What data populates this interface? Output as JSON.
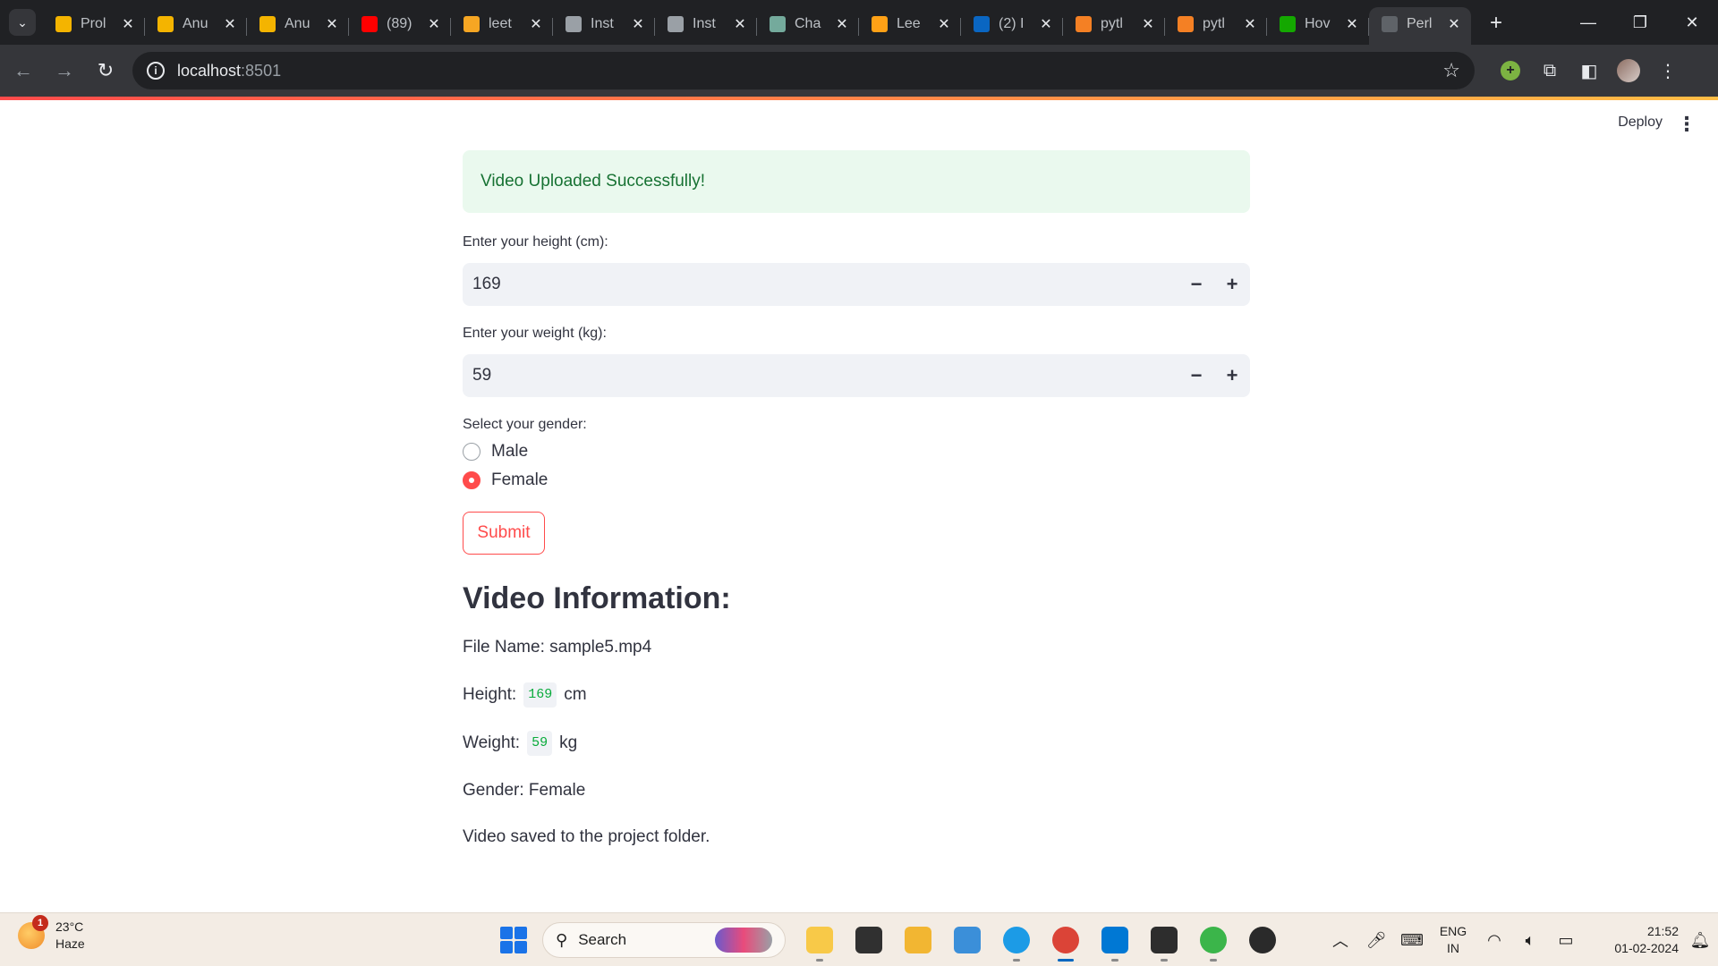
{
  "browser": {
    "tabs": [
      {
        "label": "Prol",
        "icon": "bar-chart-icon",
        "color": "#f4b400"
      },
      {
        "label": "Anu",
        "icon": "bar-chart-icon",
        "color": "#f4b400"
      },
      {
        "label": "Anu",
        "icon": "bar-chart-icon",
        "color": "#f4b400"
      },
      {
        "label": "(89)",
        "icon": "youtube-icon",
        "color": "#ff0000"
      },
      {
        "label": "leet",
        "icon": "hand-icon",
        "color": "#f6a623"
      },
      {
        "label": "Inst",
        "icon": "swirl-icon",
        "color": "#9aa0a6"
      },
      {
        "label": "Inst",
        "icon": "swirl-icon",
        "color": "#9aa0a6"
      },
      {
        "label": "Cha",
        "icon": "chatgpt-icon",
        "color": "#74aa9c"
      },
      {
        "label": "Lee",
        "icon": "leetcode-icon",
        "color": "#ffa116"
      },
      {
        "label": "(2) I",
        "icon": "linkedin-icon",
        "color": "#0a66c2"
      },
      {
        "label": "pytl",
        "icon": "stackoverflow-icon",
        "color": "#f48024"
      },
      {
        "label": "pytl",
        "icon": "stackoverflow-icon",
        "color": "#f48024"
      },
      {
        "label": "Hov",
        "icon": "upwork-icon",
        "color": "#14a800"
      },
      {
        "label": "Perl",
        "icon": "loading-icon",
        "color": "#5f6368"
      }
    ],
    "url_host": "localhost",
    "url_port": ":8501"
  },
  "app": {
    "deploy_label": "Deploy",
    "success_message": "Video Uploaded Successfully!",
    "height_label": "Enter your height (cm):",
    "height_value": "169",
    "weight_label": "Enter your weight (kg):",
    "weight_value": "59",
    "gender_label": "Select your gender:",
    "gender_options": [
      "Male",
      "Female"
    ],
    "gender_selected": "Female",
    "submit_label": "Submit",
    "info_heading": "Video Information:",
    "file_name_line": "File Name: sample5.mp4",
    "height_prefix": "Height:",
    "height_code": "169",
    "height_unit": "cm",
    "weight_prefix": "Weight:",
    "weight_code": "59",
    "weight_unit": "kg",
    "gender_line": "Gender: Female",
    "saved_line": "Video saved to the project folder."
  },
  "taskbar": {
    "weather_badge": "1",
    "temperature": "23°C",
    "condition": "Haze",
    "search_placeholder": "Search",
    "apps": [
      {
        "name": "file-explorer",
        "color": "#f8c948"
      },
      {
        "name": "task-view",
        "color": "#303030"
      },
      {
        "name": "folder",
        "color": "#f2b632"
      },
      {
        "name": "notepad",
        "color": "#3b8fd9"
      },
      {
        "name": "edge",
        "color": "#1c9be6"
      },
      {
        "name": "chrome",
        "color": "#db4437"
      },
      {
        "name": "vscode",
        "color": "#0078d4"
      },
      {
        "name": "terminal",
        "color": "#2d2d2d"
      },
      {
        "name": "loader",
        "color": "#3bb54a"
      },
      {
        "name": "obs",
        "color": "#2a2a2a"
      }
    ],
    "lang_top": "ENG",
    "lang_bottom": "IN",
    "time": "21:52",
    "date": "01-02-2024"
  }
}
